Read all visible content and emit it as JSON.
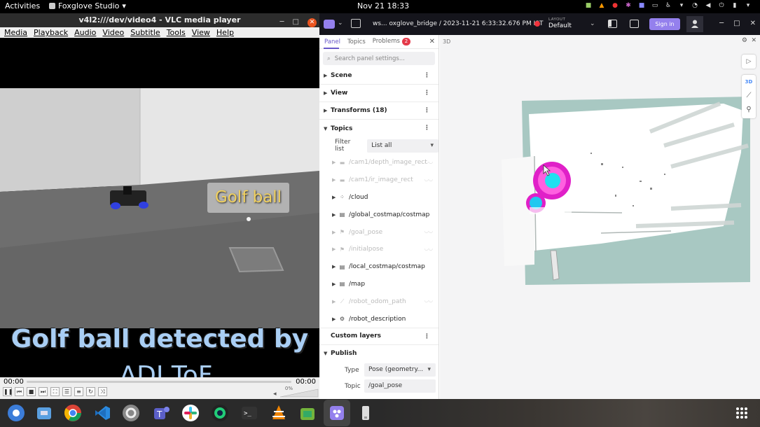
{
  "topbar": {
    "activities": "Activities",
    "app_name": "Foxglove Studio",
    "app_arrow": "▾",
    "clock": "Nov 21  18:33"
  },
  "vlc": {
    "title": "v4l2:///dev/video4 - VLC media player",
    "menu": [
      "Media",
      "Playback",
      "Audio",
      "Video",
      "Subtitle",
      "Tools",
      "View",
      "Help"
    ],
    "overlay_label": "Golf ball",
    "caption_line1": "Golf ball detected by",
    "caption_line2": "ADI ToF",
    "time_elapsed": "00:00",
    "time_total": "00:00",
    "volume": "0%"
  },
  "foxglove": {
    "source": "ws... oxglove_bridge  /  2023-11-21 6:33:32.676 PM IST",
    "layout_label": "LAYOUT",
    "layout_value": "Default",
    "signin": "Sign in",
    "sidebar": {
      "tabs": [
        "Panel",
        "Topics",
        "Problems"
      ],
      "problems_count": "2",
      "search_placeholder": "Search panel settings...",
      "sections": [
        "Scene",
        "View",
        "Transforms (18)",
        "Topics"
      ],
      "filter_label": "Filter list",
      "filter_value": "List all",
      "topics": [
        {
          "name": "/cam1/depth_image_rect",
          "dim": true,
          "icon": "image-icon"
        },
        {
          "name": "/cam1/ir_image_rect",
          "dim": true,
          "icon": "image-icon"
        },
        {
          "name": "/cloud",
          "dim": false,
          "icon": "pointcloud-icon"
        },
        {
          "name": "/global_costmap/costmap",
          "dim": false,
          "icon": "grid-icon"
        },
        {
          "name": "/goal_pose",
          "dim": true,
          "icon": "flag-icon"
        },
        {
          "name": "/initialpose",
          "dim": true,
          "icon": "flag-icon"
        },
        {
          "name": "/local_costmap/costmap",
          "dim": false,
          "icon": "grid-icon"
        },
        {
          "name": "/map",
          "dim": false,
          "icon": "grid-icon"
        },
        {
          "name": "/robot_odom_path",
          "dim": true,
          "icon": "path-icon"
        },
        {
          "name": "/robot_description",
          "dim": false,
          "icon": "robot-icon"
        }
      ],
      "custom_layers": "Custom layers",
      "publish": "Publish",
      "publish_type_label": "Type",
      "publish_type_value": "Pose (geometry...",
      "publish_topic_label": "Topic",
      "publish_topic_value": "/goal_pose"
    },
    "panel3d": {
      "title": "3D",
      "tool_3d": "3D"
    }
  },
  "colors": {
    "foxglove_accent": "#9480ed",
    "record_red": "#f0323c",
    "caption_blue": "#a9cef4",
    "costmap_teal": "#a8c8c2",
    "costmap_magenta": "#e020c8",
    "costmap_cyan": "#20e0f0"
  }
}
